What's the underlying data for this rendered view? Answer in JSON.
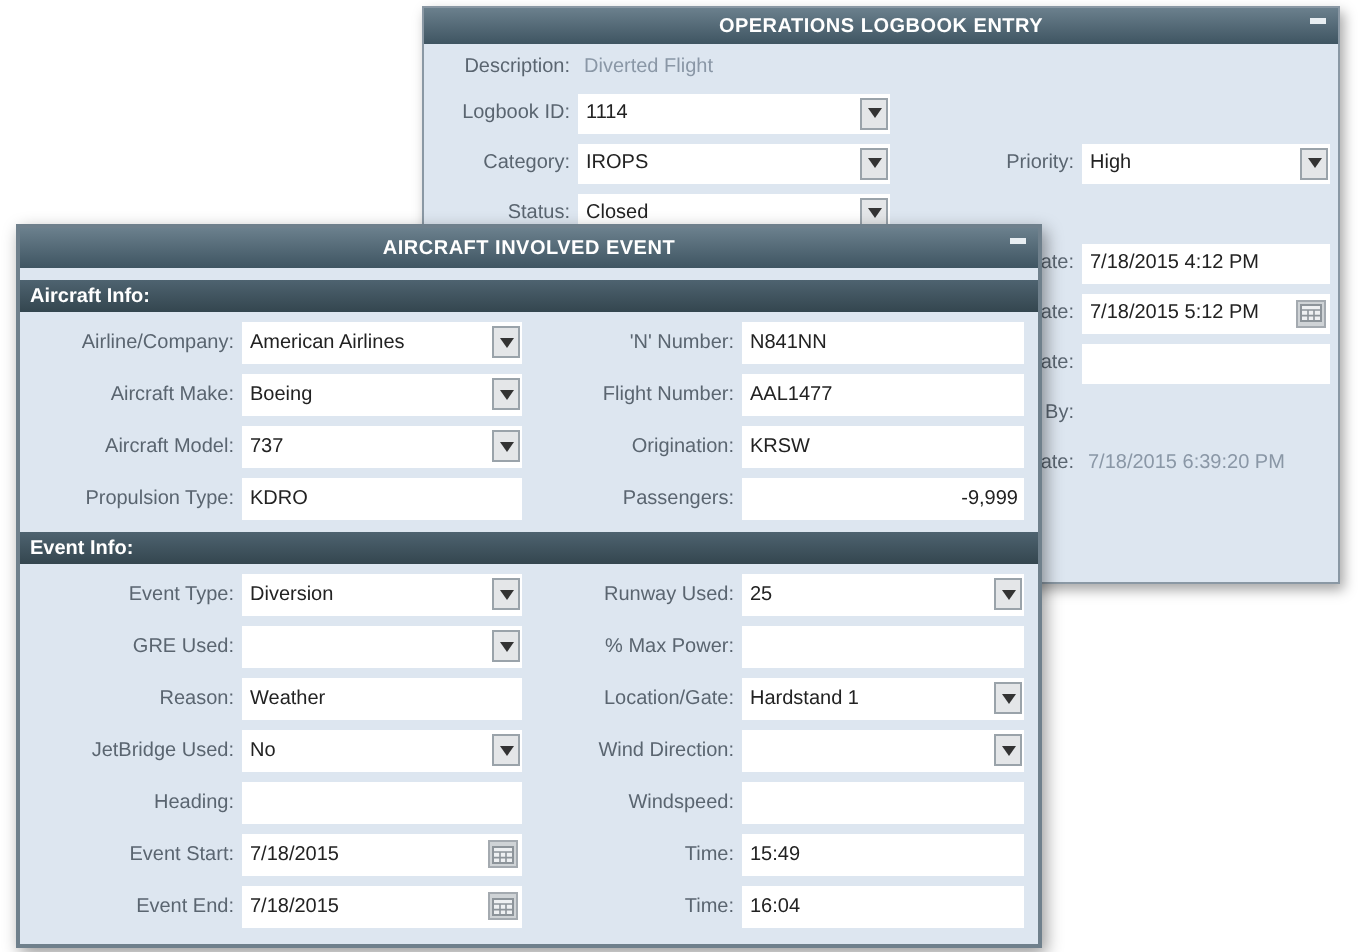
{
  "back_window": {
    "title": "OPERATIONS LOGBOOK ENTRY",
    "rows": [
      {
        "left": {
          "label": "Description:",
          "value": "Diverted Flight",
          "kind": "text"
        }
      },
      {
        "left": {
          "label": "Logbook ID:",
          "value": "1114",
          "kind": "select"
        }
      },
      {
        "left": {
          "label": "Category:",
          "value": "IROPS",
          "kind": "select"
        },
        "right": {
          "label": "Priority:",
          "value": "High",
          "kind": "select"
        }
      },
      {
        "left": {
          "label": "Status:",
          "value": "Closed",
          "kind": "select"
        }
      },
      {
        "right": {
          "label": "ate:",
          "value": "7/18/2015 4:12 PM",
          "kind": "input"
        }
      },
      {
        "right": {
          "label": "ate:",
          "value": "7/18/2015 5:12 PM",
          "kind": "date"
        }
      },
      {
        "right": {
          "label": "ate:",
          "kind": "input"
        }
      },
      {
        "right": {
          "label": "By:",
          "kind": "text"
        }
      },
      {
        "right": {
          "label": "ate:",
          "value": "7/18/2015 6:39:20 PM",
          "kind": "text"
        }
      }
    ]
  },
  "front_window": {
    "title": "AIRCRAFT INVOLVED EVENT",
    "sections": [
      {
        "title": "Aircraft Info:",
        "rows": [
          {
            "left": {
              "label": "Airline/Company:",
              "value": "American Airlines",
              "kind": "select"
            },
            "right": {
              "label": "'N' Number:",
              "value": "N841NN",
              "kind": "input"
            }
          },
          {
            "left": {
              "label": "Aircraft Make:",
              "value": "Boeing",
              "kind": "select"
            },
            "right": {
              "label": "Flight Number:",
              "value": "AAL1477",
              "kind": "input"
            }
          },
          {
            "left": {
              "label": "Aircraft Model:",
              "value": "737",
              "kind": "select"
            },
            "right": {
              "label": "Origination:",
              "value": "KRSW",
              "kind": "input"
            }
          },
          {
            "left": {
              "label": "Propulsion Type:",
              "value": "KDRO",
              "kind": "input"
            },
            "right": {
              "label": "Passengers:",
              "value": "-9,999",
              "kind": "number"
            }
          }
        ]
      },
      {
        "title": "Event Info:",
        "rows": [
          {
            "left": {
              "label": "Event Type:",
              "value": "Diversion",
              "kind": "select"
            },
            "right": {
              "label": "Runway Used:",
              "value": "25",
              "kind": "select"
            }
          },
          {
            "left": {
              "label": "GRE Used:",
              "kind": "select"
            },
            "right": {
              "label": "% Max Power:",
              "kind": "input"
            }
          },
          {
            "left": {
              "label": "Reason:",
              "value": "Weather",
              "kind": "input"
            },
            "right": {
              "label": "Location/Gate:",
              "value": "Hardstand 1",
              "kind": "select"
            }
          },
          {
            "left": {
              "label": "JetBridge Used:",
              "value": "No",
              "kind": "select"
            },
            "right": {
              "label": "Wind Direction:",
              "kind": "select"
            }
          },
          {
            "left": {
              "label": "Heading:",
              "kind": "input"
            },
            "right": {
              "label": "Windspeed:",
              "kind": "input"
            }
          },
          {
            "left": {
              "label": "Event Start:",
              "value": "7/18/2015",
              "kind": "date"
            },
            "right": {
              "label": "Time:",
              "value": "15:49",
              "kind": "input"
            }
          },
          {
            "left": {
              "label": "Event End:",
              "value": "7/18/2015",
              "kind": "date"
            },
            "right": {
              "label": "Time:",
              "value": "16:04",
              "kind": "input"
            }
          }
        ]
      }
    ]
  }
}
